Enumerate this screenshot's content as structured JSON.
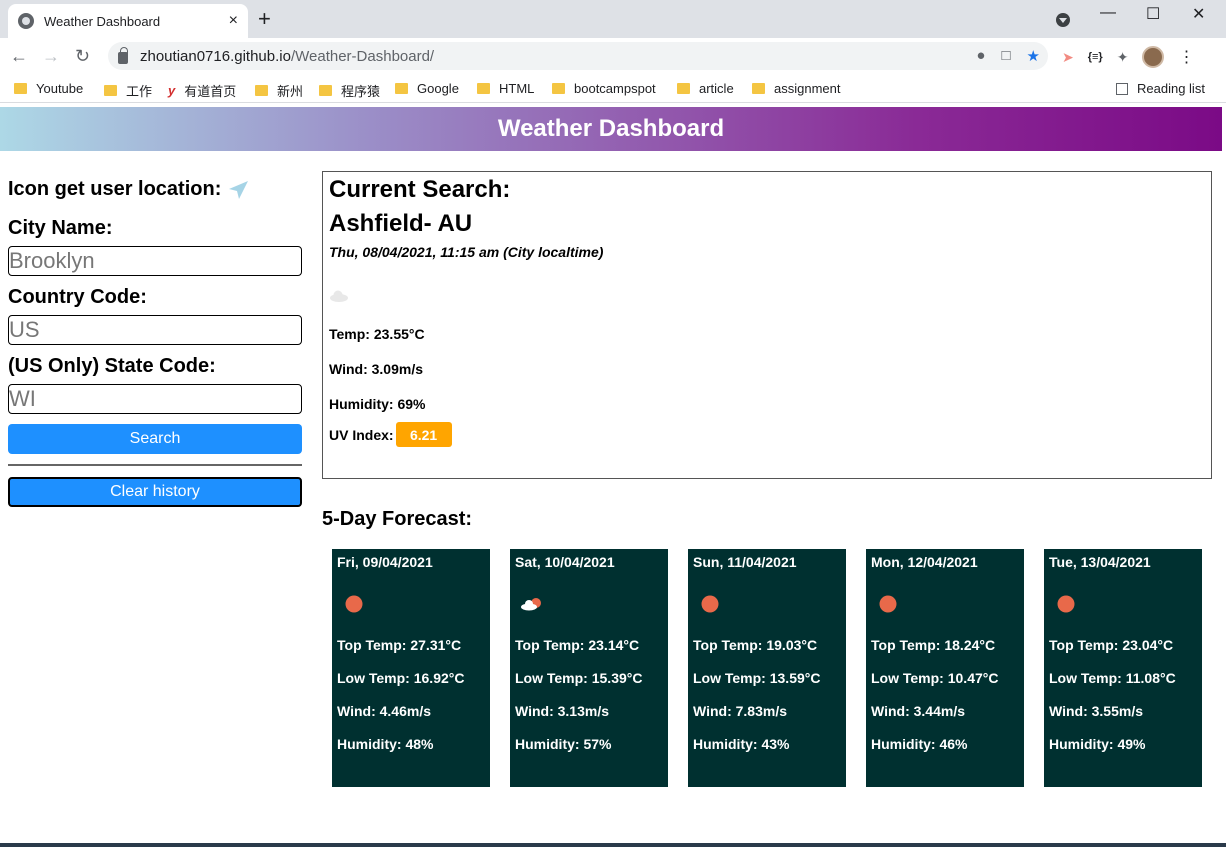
{
  "browser": {
    "tab_title": "Weather Dashboard",
    "tab_close": "×",
    "new_tab": "+",
    "url_host": "zhoutian0716.github.io",
    "url_path": "/Weather-Dashboard/",
    "bookmarks": [
      {
        "label": "Youtube",
        "icon": "folder"
      },
      {
        "label": "工作",
        "icon": "folder"
      },
      {
        "label": "有道首页",
        "icon": "youdao-logo"
      },
      {
        "label": "新州",
        "icon": "folder"
      },
      {
        "label": "程序猿",
        "icon": "folder"
      },
      {
        "label": "Google",
        "icon": "folder"
      },
      {
        "label": "HTML",
        "icon": "folder"
      },
      {
        "label": "bootcampspot",
        "icon": "folder"
      },
      {
        "label": "article",
        "icon": "folder"
      },
      {
        "label": "assignment",
        "icon": "folder"
      }
    ],
    "reading_list": "Reading list"
  },
  "header": {
    "title": "Weather Dashboard"
  },
  "sidebar": {
    "location_label": "Icon get user location:",
    "city_label": "City Name:",
    "city_placeholder": "Brooklyn",
    "country_label": "Country Code:",
    "country_placeholder": "US",
    "state_label": "(US Only) State Code:",
    "state_placeholder": "WI",
    "search_label": "Search",
    "clear_label": "Clear history"
  },
  "current": {
    "heading": "Current Search:",
    "city": "Ashfield- AU",
    "datetime": "Thu, 08/04/2021, 11:15 am (City localtime)",
    "icon": "cloud-icon",
    "temp": "Temp: 23.55°C",
    "wind": "Wind: 3.09m/s",
    "humidity": "Humidity: 69%",
    "uv_label": "UV Index:",
    "uv_value": "6.21",
    "uv_color": "#ffa500"
  },
  "forecast": {
    "title": "5-Day Forecast:",
    "days": [
      {
        "date": "Fri, 09/04/2021",
        "icon": "sun-icon",
        "top": "Top Temp: 27.31°C",
        "low": "Low Temp: 16.92°C",
        "wind": "Wind: 4.46m/s",
        "humidity": "Humidity: 48%"
      },
      {
        "date": "Sat, 10/04/2021",
        "icon": "partly-cloudy-icon",
        "top": "Top Temp: 23.14°C",
        "low": "Low Temp: 15.39°C",
        "wind": "Wind: 3.13m/s",
        "humidity": "Humidity: 57%"
      },
      {
        "date": "Sun, 11/04/2021",
        "icon": "sun-icon",
        "top": "Top Temp: 19.03°C",
        "low": "Low Temp: 13.59°C",
        "wind": "Wind: 7.83m/s",
        "humidity": "Humidity: 43%"
      },
      {
        "date": "Mon, 12/04/2021",
        "icon": "sun-icon",
        "top": "Top Temp: 18.24°C",
        "low": "Low Temp: 10.47°C",
        "wind": "Wind: 3.44m/s",
        "humidity": "Humidity: 46%"
      },
      {
        "date": "Tue, 13/04/2021",
        "icon": "sun-icon",
        "top": "Top Temp: 23.04°C",
        "low": "Low Temp: 11.08°C",
        "wind": "Wind: 3.55m/s",
        "humidity": "Humidity: 49%"
      }
    ]
  },
  "colors": {
    "accent_button": "#1e90ff",
    "card_bg": "#003030",
    "sun": "#e8694a"
  }
}
